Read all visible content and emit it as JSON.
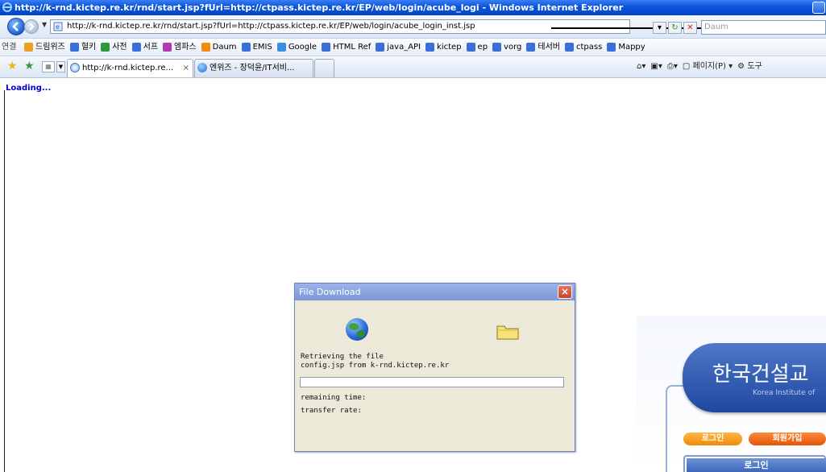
{
  "window": {
    "title": "http://k-rnd.kictep.re.kr/rnd/start.jsp?fUrl=http://ctpass.kictep.re.kr/EP/web/login/acube_logi - Windows Internet Explorer"
  },
  "address_bar": {
    "url": "http://k-rnd.kictep.re.kr/rnd/start.jsp?fUrl=http://ctpass.kictep.re.kr/EP/web/login/acube_login_inst.jsp",
    "search_placeholder": "Daum"
  },
  "links_bar": {
    "label": "연결",
    "items": [
      "드림위즈",
      "혈키",
      "사전",
      "서프",
      "엠파스",
      "Daum",
      "EMIS",
      "Google",
      "HTML Ref",
      "java_API",
      "kictep",
      "ep",
      "vorg",
      "테서버",
      "ctpass",
      "Mappy"
    ]
  },
  "tabs": [
    {
      "label": "http://k-rnd.kictep.re...",
      "close": "×"
    },
    {
      "label": "엔위즈 - 장덕윤/IT서비..."
    }
  ],
  "command_bar": {
    "page_label": "페이지(P)",
    "tools_label": "도구"
  },
  "page": {
    "loading_text": "Loading..."
  },
  "site": {
    "title": "한국건설교",
    "subtitle": "Korea Institute of",
    "login_button": "로그인",
    "join_button": "회원가입",
    "login_header": "로그인"
  },
  "dialog": {
    "title": "File Download",
    "close": "×",
    "line1": "Retrieving the file",
    "line2": "config.jsp from k-rnd.kictep.re.kr",
    "remaining_label": "remaining time:",
    "rate_label": "transfer rate:",
    "progress_fraction": 0.0
  },
  "colors": {
    "titlebar": "#0a54d8",
    "loading_text": "#0000cc",
    "dialog_title": "#7d97d8",
    "site_banner": "#2f58b0",
    "login_button": "#f59a1c",
    "join_button": "#e86a1c"
  }
}
